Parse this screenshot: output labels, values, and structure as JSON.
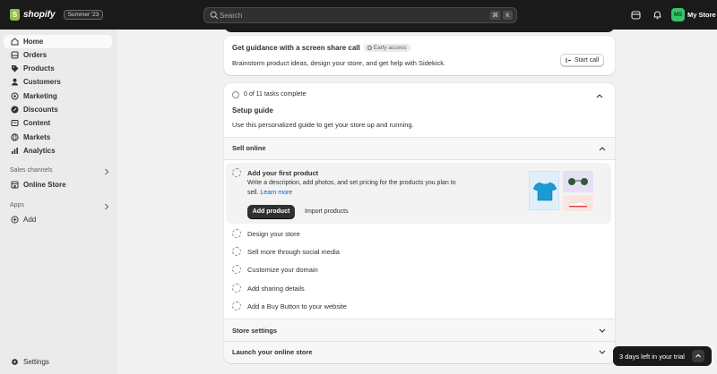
{
  "topbar": {
    "brand": "shopify",
    "edition_badge": "Summer '23",
    "search_placeholder": "Search",
    "shortcut_keys": [
      "⌘",
      "K"
    ],
    "store_initials": "MS",
    "store_name": "My Store",
    "icons": [
      "search-icon",
      "bell-icon",
      "store-icon"
    ]
  },
  "sidebar": {
    "items": [
      {
        "label": "Home",
        "icon": "home-icon"
      },
      {
        "label": "Orders",
        "icon": "orders-icon"
      },
      {
        "label": "Products",
        "icon": "tag-icon"
      },
      {
        "label": "Customers",
        "icon": "person-icon"
      },
      {
        "label": "Marketing",
        "icon": "target-icon"
      },
      {
        "label": "Discounts",
        "icon": "discount-icon"
      },
      {
        "label": "Content",
        "icon": "content-icon"
      },
      {
        "label": "Markets",
        "icon": "globe-icon"
      },
      {
        "label": "Analytics",
        "icon": "chart-icon"
      }
    ],
    "sales_channels_label": "Sales channels",
    "online_store": "Online Store",
    "apps_label": "Apps",
    "add_label": "Add",
    "settings_label": "Settings"
  },
  "guidance": {
    "title": "Get guidance with a screen share call",
    "badge": "Early access",
    "description": "Brainstorm product ideas, design your store, and get help with Sidekick.",
    "start_call": "Start call"
  },
  "setup": {
    "progress": "0 of 11 tasks complete",
    "title": "Setup guide",
    "subtitle": "Use this personalized guide to get your store up and running.",
    "sell_online": "Sell online",
    "first_product": {
      "title": "Add your first product",
      "desc_line1": "Write a description, add photos, and set pricing for the products you plan to",
      "desc_line2": "sell.",
      "learn_more": "Learn more",
      "add_product": "Add product",
      "import_products": "Import products"
    },
    "tasks": [
      "Design your store",
      "Sell more through social media",
      "Customize your domain",
      "Add sharing details",
      "Add a Buy Button to your website"
    ],
    "store_settings": "Store settings",
    "launch_store": "Launch your online store"
  },
  "trial": {
    "text": "3 days left in your trial"
  },
  "colors": {
    "topbar": "#1a1a1a",
    "brand_green": "#95bf47",
    "avatar_green": "#36c46b",
    "link_blue": "#005bd3"
  }
}
